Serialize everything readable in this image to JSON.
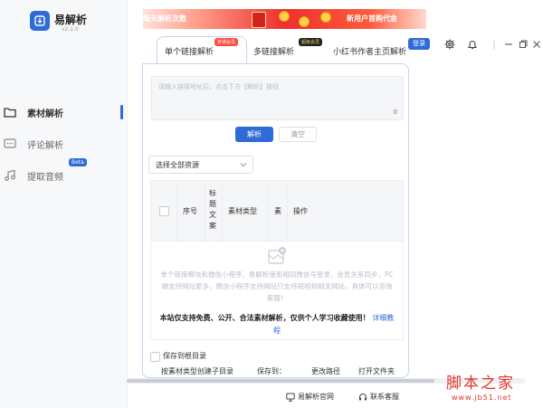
{
  "app": {
    "name": "易解析",
    "version": "v2.1.0"
  },
  "sidebar": {
    "items": [
      {
        "label": "素材解析",
        "icon": "folder-icon",
        "active": true
      },
      {
        "label": "评论解析",
        "icon": "comment-icon",
        "active": false
      },
      {
        "label": "提取音频",
        "icon": "music-icon",
        "active": false,
        "badge": "Beta"
      }
    ]
  },
  "banner": {
    "left_text": "每天解析次数",
    "right_text": "新用户首购代金"
  },
  "tabs": [
    {
      "label": "单个链接解析",
      "badge": "普通会员",
      "active": true
    },
    {
      "label": "多链接解析",
      "badge": "超级会员",
      "active": false
    },
    {
      "label": "小红书作者主页解析",
      "active": false
    }
  ],
  "header": {
    "login_label": "登录"
  },
  "input": {
    "placeholder": "请输入链接地址后，点击下方【解析】按钮",
    "count": "0"
  },
  "actions": {
    "parse_label": "解析",
    "clear_label": "清空"
  },
  "resource_select": {
    "value": "选择全部资源"
  },
  "table": {
    "columns": [
      "序号",
      "标题文案",
      "素材类型",
      "素",
      "操作"
    ],
    "empty_text": "单个链接模块和微信小程序、易解析使用相同微信号登录，会员关系同步，PC端支持网站更多，微信小程序支持网站只支持短视频相关网站，具体可以咨询客服！",
    "notice": "本站仅支持免费、公开、合法素材解析，仅供个人学习收藏使用！",
    "notice_link": "详细教程"
  },
  "options": {
    "save_root": "保存到根目录",
    "subdir_label": "按素材类型创建子目录",
    "save_to": "保存到：",
    "change_path": "更改路径",
    "open_folder": "打开文件夹"
  },
  "footer": {
    "official_site": "易解析官网",
    "contact": "联系客服"
  },
  "watermark": {
    "title": "脚本之家",
    "url": "www.jb51.net"
  },
  "colors": {
    "primary": "#2f6bd8",
    "banner_red": "#ee2f2f",
    "badge_red": "#ff4b3e"
  }
}
